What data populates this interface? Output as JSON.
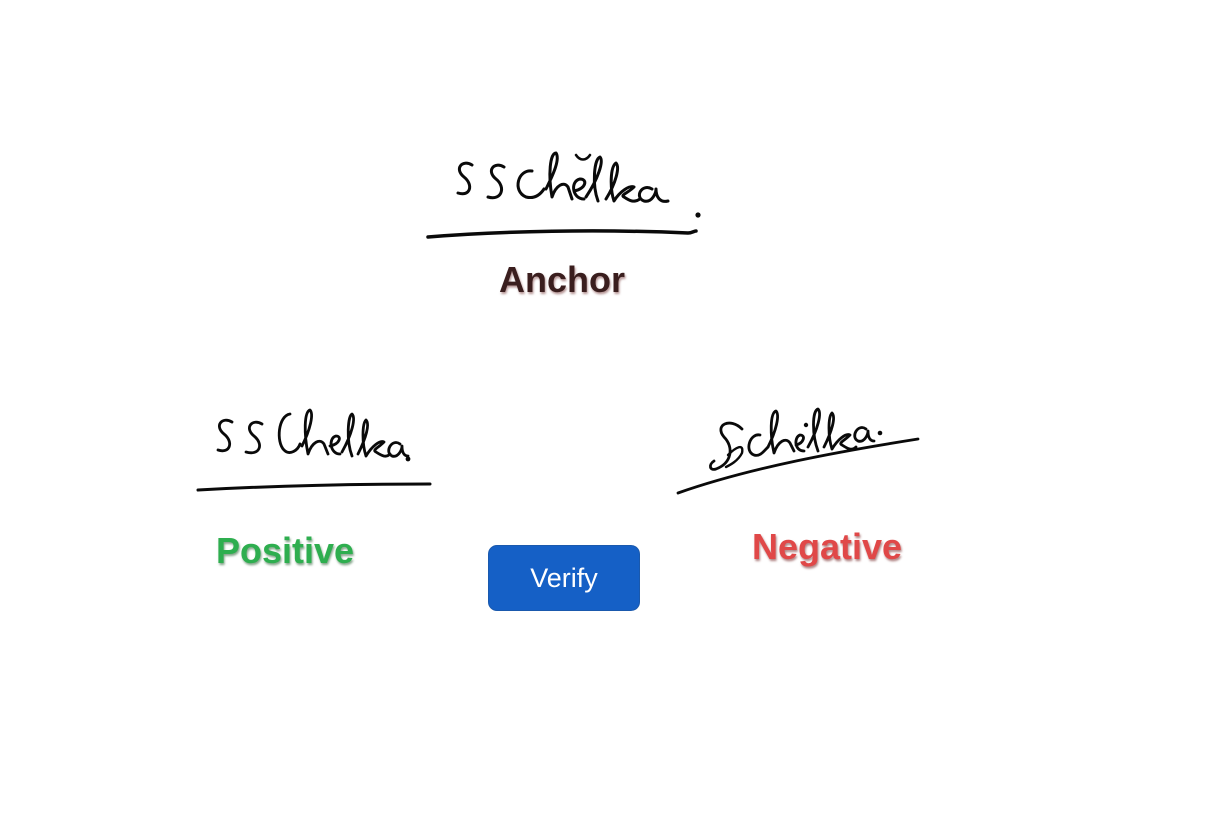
{
  "anchor": {
    "label": "Anchor",
    "signature_text": "ssChelka.",
    "color": "#3a1e1e"
  },
  "positive": {
    "label": "Positive",
    "signature_text": "ssChelka.",
    "color": "#2eae4f"
  },
  "negative": {
    "label": "Negative",
    "signature_text": "sChelka.",
    "color": "#e04848"
  },
  "verify": {
    "label": "Verify",
    "color": "#1560c6"
  }
}
